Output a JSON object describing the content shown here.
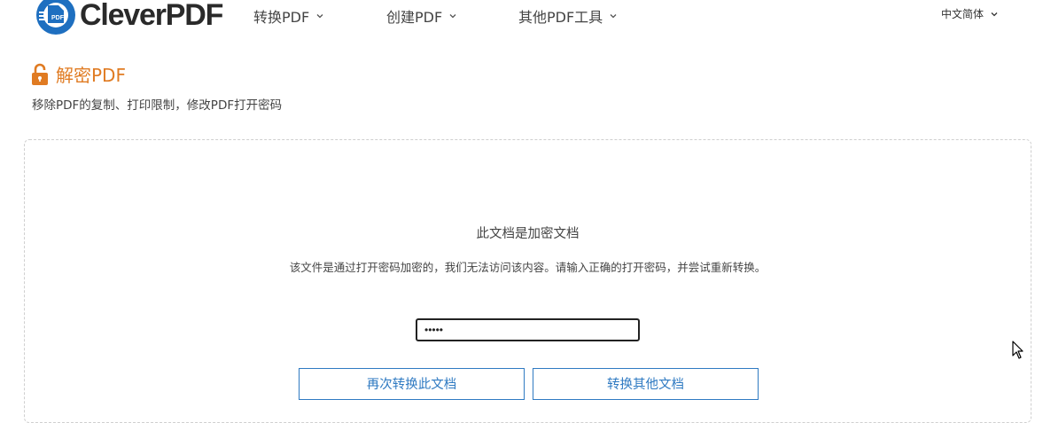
{
  "header": {
    "logo_text": "CleverPDF",
    "logo_badge": "PDF",
    "nav": [
      {
        "label": "转换PDF"
      },
      {
        "label": "创建PDF"
      },
      {
        "label": "其他PDF工具"
      }
    ],
    "language": "中文简体"
  },
  "page": {
    "title": "解密PDF",
    "subtitle": "移除PDF的复制、打印限制，修改PDF打开密码"
  },
  "encrypted": {
    "heading": "此文档是加密文档",
    "description": "该文件是通过打开密码加密的，我们无法访问该内容。请输入正确的打开密码，并尝试重新转换。",
    "password_value": "•••••"
  },
  "buttons": {
    "retry": "再次转换此文档",
    "other": "转换其他文档"
  },
  "colors": {
    "accent_orange": "#e07b22",
    "brand_blue": "#2f7ac2",
    "logo_blue": "#1e6fc0"
  },
  "icons": {
    "logo": "cleverpdf-logo-icon",
    "unlock": "unlock-icon",
    "chevron": "chevron-down-icon",
    "cursor": "mouse-pointer-icon"
  }
}
